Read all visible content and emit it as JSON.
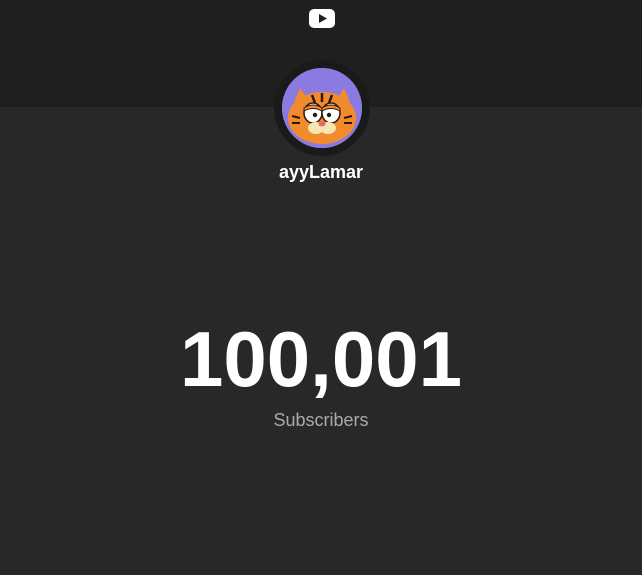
{
  "header": {
    "logo_icon": "youtube-play-icon"
  },
  "channel": {
    "name": "ayyLamar",
    "avatar_icon": "garfield-avatar"
  },
  "stats": {
    "subscriber_count": "100,001",
    "subscriber_label": "Subscribers"
  },
  "colors": {
    "background": "#282828",
    "header_band": "#1f1f1f",
    "avatar_bg": "#8b7be0",
    "primary_text": "#ffffff",
    "secondary_text": "#aaaaaa"
  }
}
